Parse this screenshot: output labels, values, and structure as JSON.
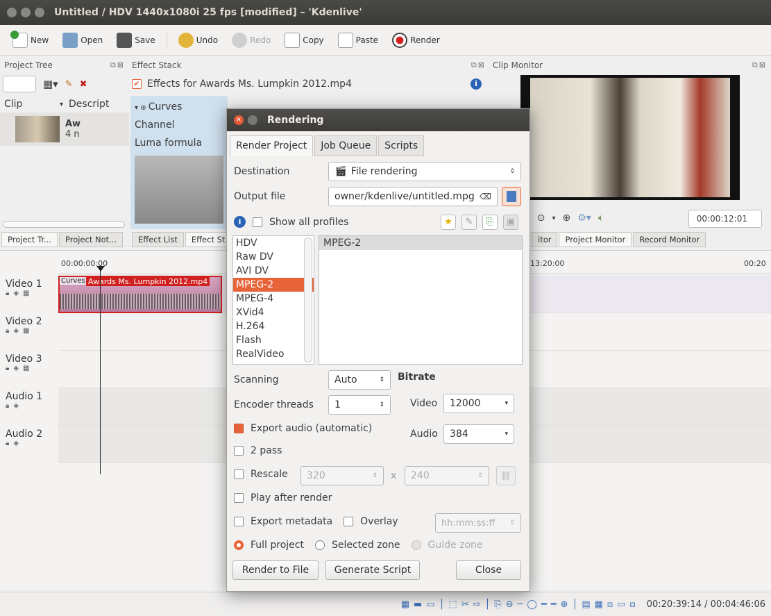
{
  "window": {
    "title": "Untitled / HDV 1440x1080i 25 fps [modified] – 'Kdenlive'"
  },
  "toolbar": [
    {
      "label": "New",
      "icon": "new-icon",
      "enabled": true
    },
    {
      "label": "Open",
      "icon": "open-folder-icon",
      "enabled": true
    },
    {
      "label": "Save",
      "icon": "save-icon",
      "enabled": true
    },
    {
      "label": "Undo",
      "icon": "undo-icon",
      "enabled": true
    },
    {
      "label": "Redo",
      "icon": "redo-icon",
      "enabled": false
    },
    {
      "label": "Copy",
      "icon": "copy-icon",
      "enabled": true
    },
    {
      "label": "Paste",
      "icon": "paste-icon",
      "enabled": true
    },
    {
      "label": "Render",
      "icon": "render-icon",
      "enabled": true
    }
  ],
  "project_tree": {
    "title": "Project Tree",
    "col_clip": "Clip",
    "col_desc": "Descript",
    "clip_name": "Aw",
    "clip_sub": "4 n",
    "tabs": [
      "Project Tr...",
      "Project Not..."
    ]
  },
  "effect_stack": {
    "title": "Effect Stack",
    "header": "Effects for Awards Ms. Lumpkin 2012.mp4",
    "effect": "Curves",
    "channel_label": "Channel",
    "luma_label": "Luma formula",
    "tabs": [
      "Effect List",
      "Effect St"
    ]
  },
  "clip_monitor": {
    "title": "Clip Monitor",
    "timecode": "00:00:12:01",
    "tabs": [
      "itor",
      "Project Monitor",
      "Record Monitor"
    ]
  },
  "timeline": {
    "start_tc": "00:00:00:00",
    "ruler_mid": "13:20:00",
    "ruler_end": "00:20",
    "clip_label": "Awards Ms. Lumpkin 2012.mp4",
    "clip_effect": "Curves",
    "tracks": [
      "Video 1",
      "Video 2",
      "Video 3",
      "Audio 1",
      "Audio 2"
    ]
  },
  "status": {
    "timecode": "00:20:39:14 / 00:04:46:06"
  },
  "dialog": {
    "title": "Rendering",
    "tabs": [
      "Render Project",
      "Job Queue",
      "Scripts"
    ],
    "destination_label": "Destination",
    "destination_value": "File rendering",
    "output_label": "Output file",
    "output_value": "owner/kdenlive/untitled.mpg",
    "show_all_profiles": "Show all profiles",
    "formats": [
      "HDV",
      "Raw DV",
      "AVI DV",
      "MPEG-2",
      "MPEG-4",
      "XVid4",
      "H.264",
      "Flash",
      "RealVideo"
    ],
    "selected_format": "MPEG-2",
    "profiles": [
      "MPEG-2"
    ],
    "scanning_label": "Scanning",
    "scanning_value": "Auto",
    "bitrate_label": "Bitrate",
    "encoder_label": "Encoder threads",
    "encoder_value": "1",
    "video_label": "Video",
    "video_value": "12000",
    "audio_label": "Audio",
    "audio_value": "384",
    "export_audio": "Export audio (automatic)",
    "two_pass": "2 pass",
    "rescale": "Rescale",
    "rescale_w": "320",
    "rescale_x": "x",
    "rescale_h": "240",
    "play_after": "Play after render",
    "export_metadata": "Export metadata",
    "overlay": "Overlay",
    "overlay_value": "hh:mm:ss:ff",
    "full_project": "Full project",
    "selected_zone": "Selected zone",
    "guide_zone": "Guide zone",
    "render_to_file": "Render to File",
    "generate_script": "Generate Script",
    "close": "Close"
  }
}
